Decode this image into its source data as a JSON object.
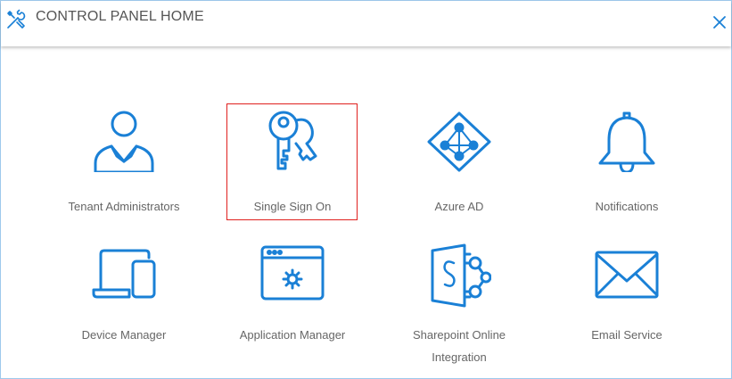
{
  "header": {
    "title": "CONTROL PANEL HOME",
    "header_icon": "tools-icon",
    "close_icon": "close-icon"
  },
  "accent_color": "#1a80d6",
  "selection_color": "#e0201e",
  "tiles": [
    {
      "label": "Tenant Administrators",
      "icon": "user-admin-icon"
    },
    {
      "label": "Single Sign On",
      "icon": "keys-icon",
      "selected": true
    },
    {
      "label": "Azure AD",
      "icon": "azure-ad-icon"
    },
    {
      "label": "Notifications",
      "icon": "bell-icon"
    },
    {
      "label": "Device Manager",
      "icon": "devices-icon"
    },
    {
      "label": "Application Manager",
      "icon": "app-window-icon"
    },
    {
      "label_line1": "Sharepoint Online",
      "label_line2": "Integration",
      "icon": "sharepoint-icon"
    },
    {
      "label": "Email Service",
      "icon": "envelope-icon"
    }
  ]
}
